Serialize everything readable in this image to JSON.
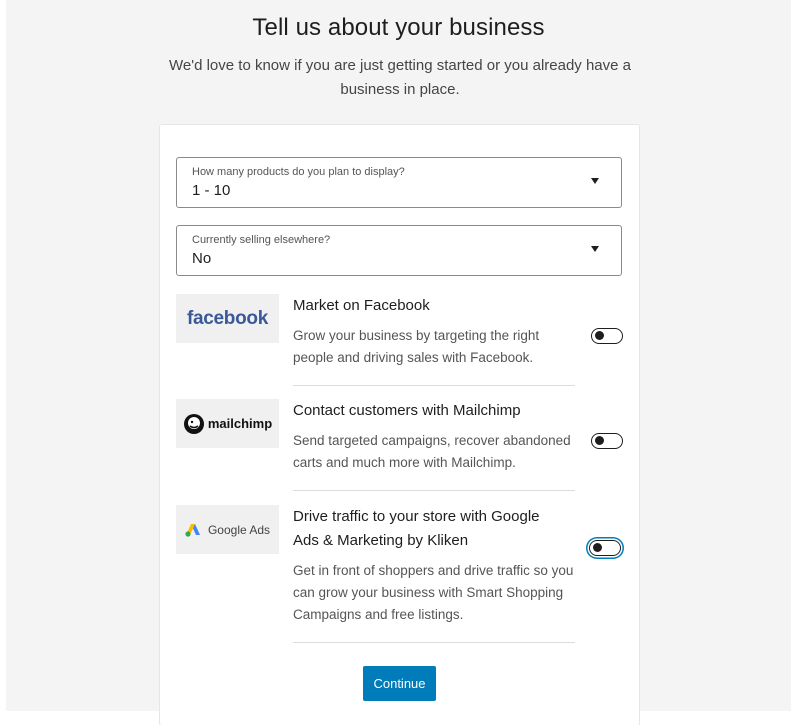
{
  "header": {
    "title": "Tell us about your business",
    "subtitle": "We'd love to know if you are just getting started or you already have a business in place."
  },
  "form": {
    "products_select": {
      "label": "How many products do you plan to display?",
      "value": "1 - 10"
    },
    "selling_select": {
      "label": "Currently selling elsewhere?",
      "value": "No"
    }
  },
  "extensions": [
    {
      "logo_text": "facebook",
      "title": "Market on Facebook",
      "description": "Grow your business by targeting the right people and driving sales with Facebook.",
      "enabled": false
    },
    {
      "logo_text": "mailchimp",
      "title": "Contact customers with Mailchimp",
      "description": "Send targeted campaigns, recover abandoned carts and much more with Mailchimp.",
      "enabled": false
    },
    {
      "logo_text": "Google Ads",
      "title": "Drive traffic to your store with Google Ads & Marketing by Kliken",
      "description": "Get in front of shoppers and drive traffic so you can grow your business with Smart Shopping Campaigns and free listings.",
      "enabled": false
    }
  ],
  "actions": {
    "continue_label": "Continue"
  },
  "colors": {
    "primary": "#007cba",
    "facebook_brand": "#3b5998",
    "background": "#f3f4f3"
  }
}
